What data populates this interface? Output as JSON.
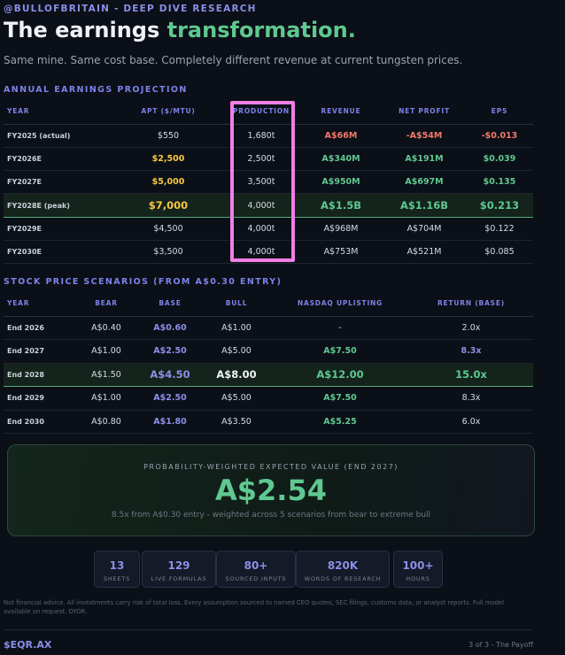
{
  "brand": "@BULLOFBRITAIN - DEEP DIVE RESEARCH",
  "title_main": "The earnings ",
  "title_accent": "transformation.",
  "subtitle": "Same mine. Same cost base. Completely different revenue at current tungsten prices.",
  "earnings": {
    "section_title": "ANNUAL EARNINGS PROJECTION",
    "headers": [
      "YEAR",
      "APT ($/MTU)",
      "PRODUCTION",
      "REVENUE",
      "NET PROFIT",
      "EPS"
    ],
    "rows": [
      {
        "year": "FY2025 (actual)",
        "apt": "$550",
        "production": "1,680t",
        "revenue": "A$66M",
        "net_profit": "-A$54M",
        "eps": "-$0.013"
      },
      {
        "year": "FY2026E",
        "apt": "$2,500",
        "production": "2,500t",
        "revenue": "A$340M",
        "net_profit": "A$191M",
        "eps": "$0.039"
      },
      {
        "year": "FY2027E",
        "apt": "$5,000",
        "production": "3,500t",
        "revenue": "A$950M",
        "net_profit": "A$697M",
        "eps": "$0.135"
      },
      {
        "year": "FY2028E (peak)",
        "apt": "$7,000",
        "production": "4,000t",
        "revenue": "A$1.5B",
        "net_profit": "A$1.16B",
        "eps": "$0.213"
      },
      {
        "year": "FY2029E",
        "apt": "$4,500",
        "production": "4,000t",
        "revenue": "A$968M",
        "net_profit": "A$704M",
        "eps": "$0.122"
      },
      {
        "year": "FY2030E",
        "apt": "$3,500",
        "production": "4,000t",
        "revenue": "A$753M",
        "net_profit": "A$521M",
        "eps": "$0.085"
      }
    ]
  },
  "scenarios": {
    "section_title": "STOCK PRICE SCENARIOS (FROM A$0.30 ENTRY)",
    "headers": [
      "YEAR",
      "BEAR",
      "BASE",
      "BULL",
      "NASDAQ UPLISTING",
      "RETURN (BASE)"
    ],
    "rows": [
      {
        "year": "End 2026",
        "bear": "A$0.40",
        "base": "A$0.60",
        "bull": "A$1.00",
        "nasdaq": "-",
        "return": "2.0x"
      },
      {
        "year": "End 2027",
        "bear": "A$1.00",
        "base": "A$2.50",
        "bull": "A$5.00",
        "nasdaq": "A$7.50",
        "return": "8.3x"
      },
      {
        "year": "End 2028",
        "bear": "A$1.50",
        "base": "A$4.50",
        "bull": "A$8.00",
        "nasdaq": "A$12.00",
        "return": "15.0x"
      },
      {
        "year": "End 2029",
        "bear": "A$1.00",
        "base": "A$2.50",
        "bull": "A$5.00",
        "nasdaq": "A$7.50",
        "return": "8.3x"
      },
      {
        "year": "End 2030",
        "bear": "A$0.80",
        "base": "A$1.80",
        "bull": "A$3.50",
        "nasdaq": "A$5.25",
        "return": "6.0x"
      }
    ]
  },
  "expected_value": {
    "label": "PROBABILITY-WEIGHTED EXPECTED VALUE (END 2027)",
    "value": "A$2.54",
    "subtext": "8.5x from A$0.30 entry - weighted across 5 scenarios from bear to extreme bull"
  },
  "stats": [
    {
      "number": "13",
      "label": "SHEETS"
    },
    {
      "number": "129",
      "label": "LIVE FORMULAS"
    },
    {
      "number": "80+",
      "label": "SOURCED INPUTS"
    },
    {
      "number": "820K",
      "label": "WORDS OF RESEARCH"
    },
    {
      "number": "100+",
      "label": "HOURS"
    }
  ],
  "disclaimer": "Not financial advice. All investments carry risk of total loss. Every assumption sourced to named CEO quotes, SEC filings, customs data, or analyst reports. Full model available on request. DYOR.",
  "footer": {
    "ticker": "$EQR.AX",
    "page": "3 of 3 - The Payoff"
  },
  "colors": {
    "accent_green": "#5fc890",
    "accent_purple": "#8b8fe6",
    "highlight_box": "#f07ee6",
    "negative": "#f07a6a",
    "yellow": "#f5c842"
  }
}
